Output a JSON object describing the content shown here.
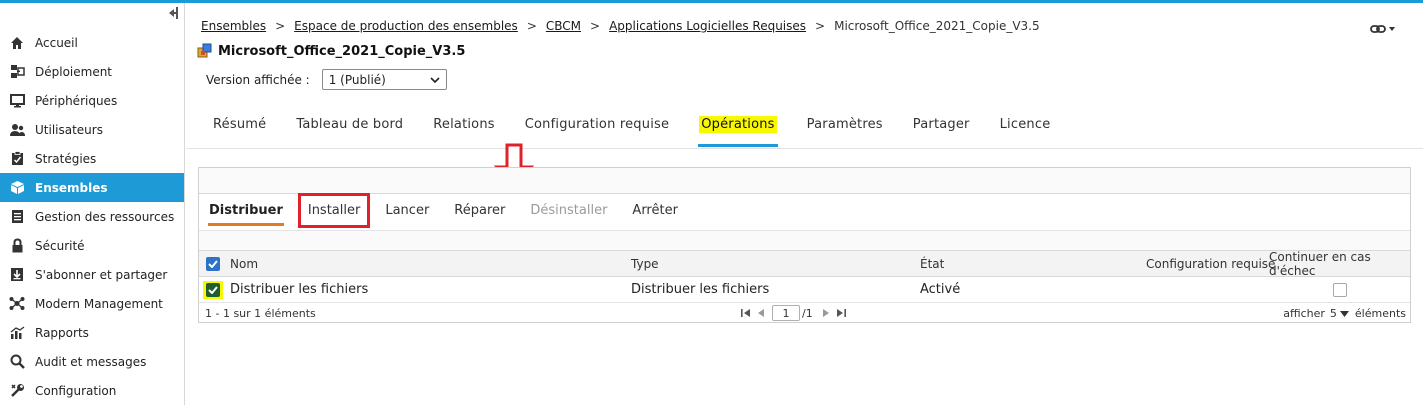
{
  "sidebar": {
    "items": [
      {
        "label": "Accueil",
        "icon": "home-icon"
      },
      {
        "label": "Déploiement",
        "icon": "deploy-icon"
      },
      {
        "label": "Périphériques",
        "icon": "monitor-icon"
      },
      {
        "label": "Utilisateurs",
        "icon": "users-icon"
      },
      {
        "label": "Stratégies",
        "icon": "policy-icon"
      },
      {
        "label": "Ensembles",
        "icon": "cube-icon"
      },
      {
        "label": "Gestion des ressources",
        "icon": "list-icon"
      },
      {
        "label": "Sécurité",
        "icon": "lock-icon"
      },
      {
        "label": "S'abonner et partager",
        "icon": "download-icon"
      },
      {
        "label": "Modern Management",
        "icon": "network-icon"
      },
      {
        "label": "Rapports",
        "icon": "chart-icon"
      },
      {
        "label": "Audit et messages",
        "icon": "magnifier-icon"
      },
      {
        "label": "Configuration",
        "icon": "wrench-icon"
      }
    ]
  },
  "breadcrumb": {
    "items": [
      "Ensembles",
      "Espace de production des ensembles",
      "CBCM",
      "Applications Logicielles Requises"
    ],
    "current": "Microsoft_Office_2021_Copie_V3.5"
  },
  "page": {
    "title": "Microsoft_Office_2021_Copie_V3.5",
    "version_label": "Version affichée :",
    "version_value": "1 (Publié)"
  },
  "tabs": [
    "Résumé",
    "Tableau de bord",
    "Relations",
    "Configuration requise",
    "Opérations",
    "Paramètres",
    "Partager",
    "Licence"
  ],
  "subtabs": [
    "Distribuer",
    "Installer",
    "Lancer",
    "Réparer",
    "Désinstaller",
    "Arrêter"
  ],
  "grid": {
    "headers": {
      "name": "Nom",
      "type": "Type",
      "state": "État",
      "config": "Configuration requise",
      "continue": "Continuer en cas d'échec"
    },
    "rows": [
      {
        "name": "Distribuer les fichiers",
        "type": "Distribuer les fichiers",
        "state": "Activé"
      }
    ]
  },
  "pager": {
    "summary": "1 - 1 sur 1 éléments",
    "page": "1",
    "total": "/1",
    "show_label": "afficher",
    "per_page": "5",
    "items_label": "éléments"
  },
  "colors": {
    "accent": "#1e9bd7",
    "highlight": "#f8f800",
    "annotation": "#e0212b",
    "subtab_underline": "#e37b22"
  }
}
